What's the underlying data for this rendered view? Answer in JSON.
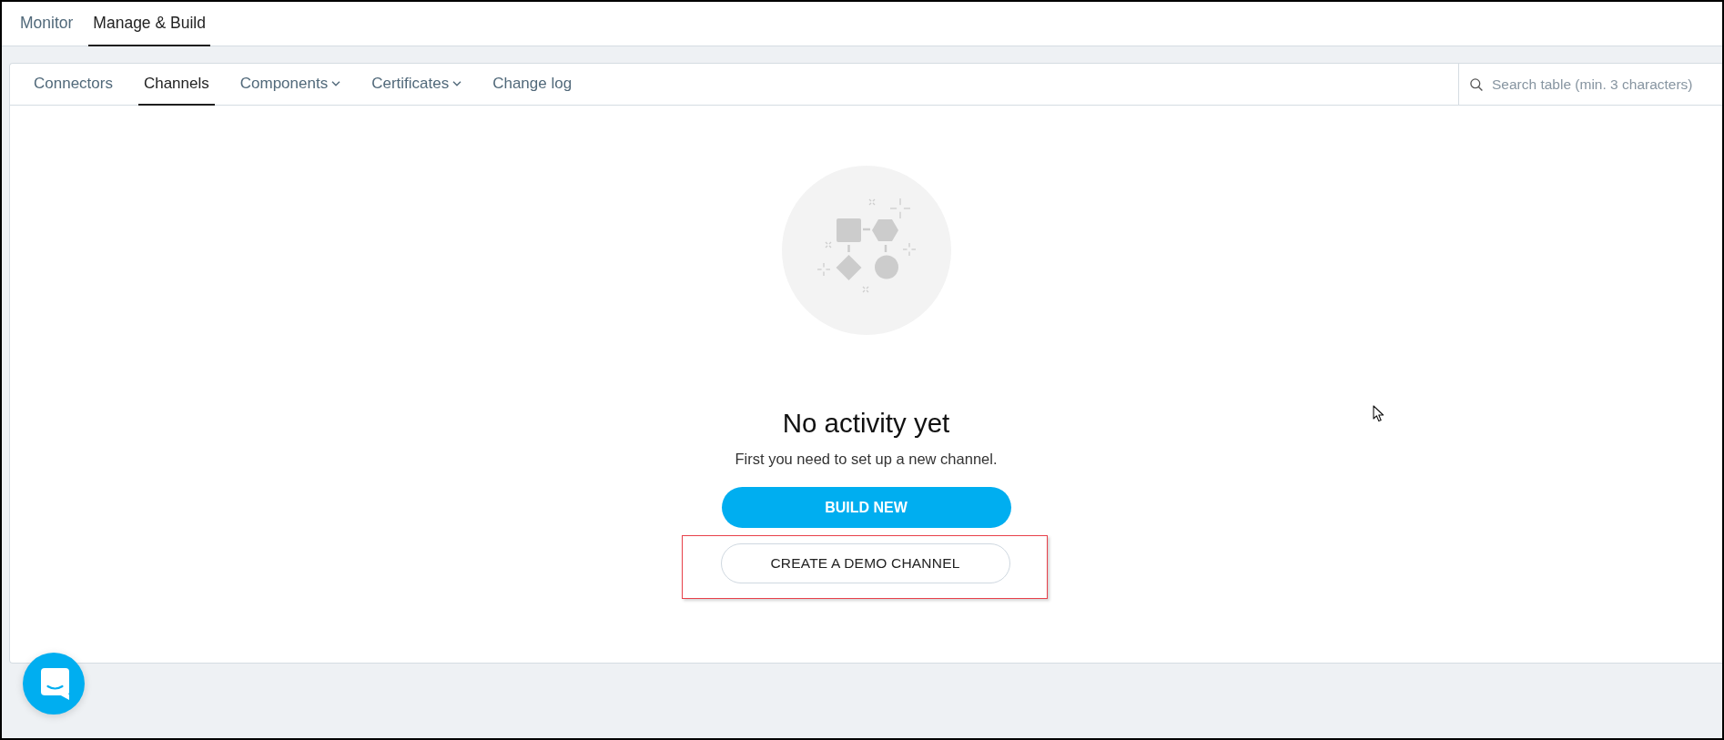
{
  "top_tabs": [
    {
      "label": "Monitor",
      "selected": false
    },
    {
      "label": "Manage & Build",
      "selected": true
    }
  ],
  "sub_tabs": [
    {
      "label": "Connectors",
      "selected": false,
      "dropdown": false
    },
    {
      "label": "Channels",
      "selected": true,
      "dropdown": false
    },
    {
      "label": "Components",
      "selected": false,
      "dropdown": true
    },
    {
      "label": "Certificates",
      "selected": false,
      "dropdown": true
    },
    {
      "label": "Change log",
      "selected": false,
      "dropdown": false
    }
  ],
  "search": {
    "placeholder": "Search table (min. 3 characters)"
  },
  "empty_state": {
    "title": "No activity yet",
    "message": "First you need to set up a new channel.",
    "buttons": [
      {
        "label": "BUILD NEW",
        "kind": "primary",
        "highlighted": false
      },
      {
        "label": "CREATE A DEMO CHANNEL",
        "kind": "secondary",
        "highlighted": true
      }
    ]
  }
}
